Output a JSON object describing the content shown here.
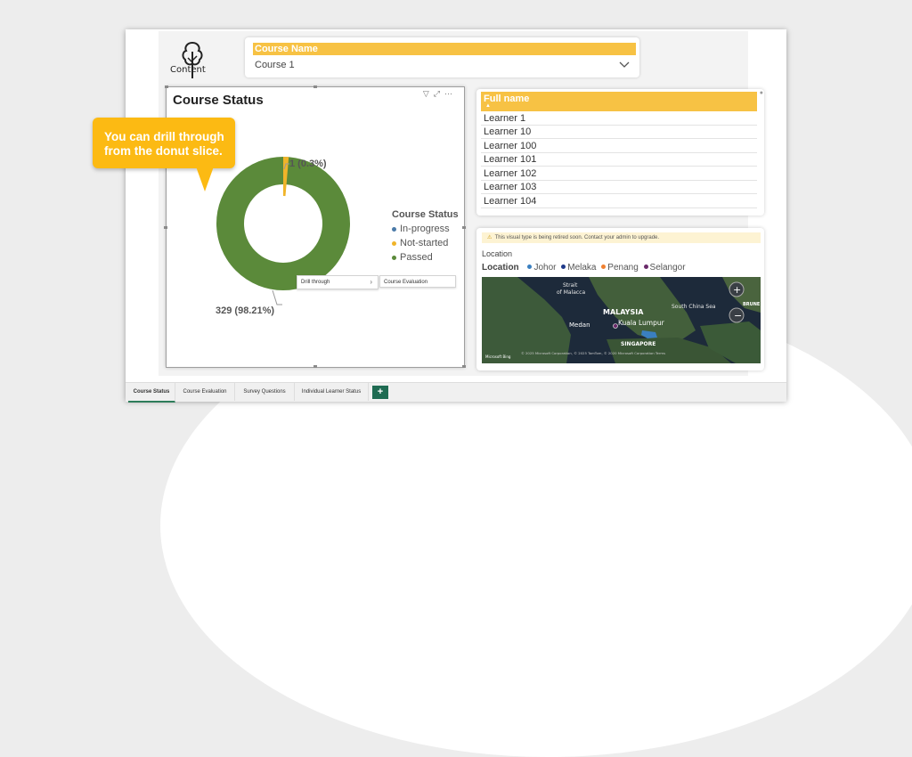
{
  "slicer": {
    "header": "Course Name",
    "value": "Course 1"
  },
  "logo": {
    "text": "Content"
  },
  "course_status": {
    "title": "Course Status",
    "label_small": "1 (0.3%)",
    "label_big": "329 (98.21%)",
    "legend_title": "Course Status",
    "legend": [
      {
        "label": "In-progress",
        "color": "#4a7aa8"
      },
      {
        "label": "Not-started",
        "color": "#f0b429"
      },
      {
        "label": "Passed",
        "color": "#5b8a3a"
      }
    ],
    "context_menu": {
      "item": "Drill through",
      "submenu": "Course Evaluation"
    }
  },
  "callout": {
    "line1": "You can drill through",
    "line2": "from the donut slice."
  },
  "learner_table": {
    "header": "Full name",
    "sort_indicator": "▲",
    "rows": [
      "Learner 1",
      "Learner 10",
      "Learner 100",
      "Learner 101",
      "Learner 102",
      "Learner 103",
      "Learner 104"
    ]
  },
  "map_visual": {
    "warning": "This visual type is being retired soon. Contact your admin to upgrade.",
    "title": "Location",
    "legend_title": "Location",
    "legend": [
      {
        "label": "Johor",
        "color": "#3a7fc0"
      },
      {
        "label": "Melaka",
        "color": "#1f3a8a"
      },
      {
        "label": "Penang",
        "color": "#f08030"
      },
      {
        "label": "Selangor",
        "color": "#6a2a6a"
      }
    ],
    "labels": {
      "strait": "Strait\nof Malacca",
      "scs": "South China Sea",
      "malaysia": "MALAYSIA",
      "kl": "Kuala Lumpur",
      "medan": "Medan",
      "singapore": "SINGAPORE",
      "brunei": "BRUNE"
    },
    "attribution": "© 2025 Microsoft Corporation, © 2025 TomTom, © 2020 Microsoft Corporation  Terms",
    "bing": "Microsoft Bing"
  },
  "tabs": [
    "Course Status",
    "Course Evaluation",
    "Survey Questions",
    "Individual Learner Status"
  ],
  "add_tab": "+"
}
